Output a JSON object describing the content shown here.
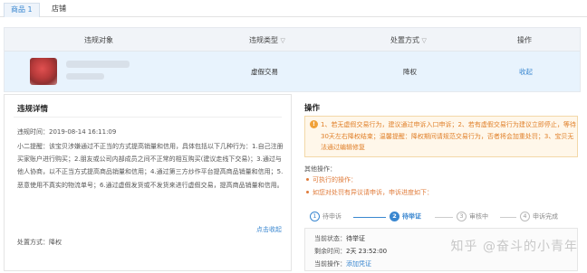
{
  "tabs": [
    {
      "label": "商品 1",
      "active": true
    },
    {
      "label": "店铺",
      "active": false
    }
  ],
  "table": {
    "headers": {
      "object": "违规对象",
      "type": "违规类型",
      "measure": "处置方式",
      "action": "操作",
      "filter_icon": "▽"
    },
    "row": {
      "type": "虚假交易",
      "measure": "降权",
      "action": "收起"
    }
  },
  "detail": {
    "title": "违规详情",
    "time_label": "违规时间：",
    "time_value": "2019-08-14 16:11:09",
    "reminder_label": "小二提醒：",
    "reminder_text": "该宝贝涉嫌通过不正当的方式提高销量和信用，具体包括以下几种行为：1.自己注册买家账户进行购买；2.朋友或公司内部成员之间不正常的相互购买(建议走线下交易)；3.通过与他人协商，以不正当方式提高商品销量和信用；4.通过第三方炒作平台提高商品销量和信用；5.恶意使用不真实的物流单号；6.通过虚假发货或不发货来进行虚假交易，提高商品销量和信用。",
    "collapse_label": "点击收起",
    "measure_label": "处置方式：",
    "measure_value": "降权"
  },
  "ops": {
    "title": "操作",
    "notice": "1、若无虚假交易行为，建议通过申诉入口申诉；2、若有虚假交易行为建议立即停止，等待30天左右降权结束；温馨提醒：降权期间请规范交易行为，否者将会加重处罚；3、宝贝无法通过编辑修复",
    "other_title": "其他操作：",
    "bullets": [
      "可执行的操作：",
      "如您对处罚有异议请申诉，申诉进度如下："
    ],
    "steps": [
      {
        "num": "1",
        "label": "待申诉"
      },
      {
        "num": "2",
        "label": "待举证"
      },
      {
        "num": "3",
        "label": "审核中"
      },
      {
        "num": "4",
        "label": "申诉完成"
      }
    ],
    "current_status_label": "当前状态：",
    "current_status_value": "待举证",
    "remaining_label": "剩余时间：",
    "remaining_value": "2天 23:52:00",
    "current_action_label": "当前操作：",
    "current_action_value": "添加凭证"
  },
  "watermark": "知乎 @奋斗的小青年",
  "colors": {
    "accent": "#3a87d0",
    "notice": "#e0802a",
    "row_highlight": "#e8f3fd"
  }
}
